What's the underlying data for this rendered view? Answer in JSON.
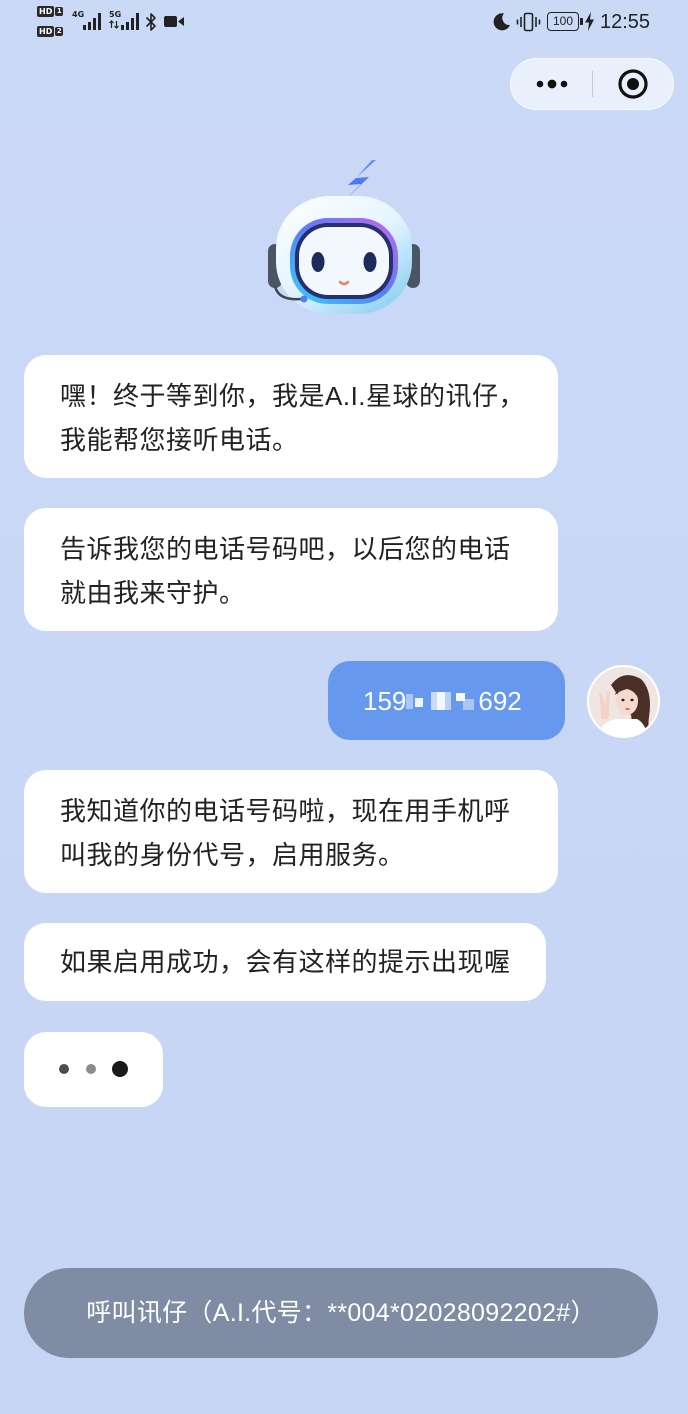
{
  "colors": {
    "background_top": "#cad9f6",
    "background_bottom": "#c6d5f4",
    "bot_bubble": "#ffffff",
    "user_bubble": "#6699ee",
    "call_button": "#7f8ca3",
    "text": "#222222",
    "text_on_dark": "#ffffff"
  },
  "status_bar": {
    "sim1_label": "HD",
    "sim1_slot": "1",
    "sim2_label": "HD",
    "sim2_slot": "2",
    "network1": "4G",
    "network2": "5G",
    "battery_level": "100",
    "time": "12:55",
    "icons": [
      "signal-bars-icon",
      "data-arrows-icon",
      "bluetooth-icon",
      "video-camera-icon",
      "moon-icon",
      "vibrate-icon",
      "battery-icon",
      "charging-bolt-icon"
    ]
  },
  "capsule": {
    "more_icon": "more-dots-icon",
    "close_icon": "target-circle-icon"
  },
  "mascot": {
    "icon": "robot-mascot-icon"
  },
  "messages": [
    {
      "outgoing": false,
      "lines": [
        "嘿！终于等到你，我是A.I.星球的讯仔，",
        "我能帮您接听电话。"
      ]
    },
    {
      "outgoing": false,
      "lines": [
        "告诉我您的电话号码吧，以后您的电话",
        "就由我来守护。"
      ]
    },
    {
      "outgoing": true,
      "phone_visible_start": "159",
      "phone_masked": true,
      "phone_visible_end": "692",
      "avatar_icon": "user-avatar-icon"
    },
    {
      "outgoing": false,
      "lines": [
        "我知道你的电话号码啦，现在用手机呼",
        "叫我的身份代号，启用服务。"
      ]
    },
    {
      "outgoing": false,
      "lines": [
        "如果启用成功，会有这样的提示出现喔"
      ]
    },
    {
      "outgoing": false,
      "typing": true
    }
  ],
  "call_button": {
    "label": "呼叫讯仔（A.I.代号：**004*02028092202#）"
  }
}
